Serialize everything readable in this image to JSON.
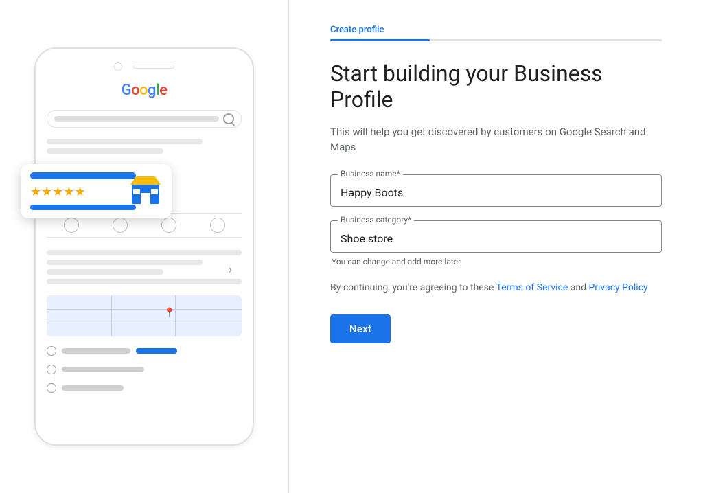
{
  "left": {
    "phone": {
      "google_logo": "Google",
      "stars": "★★★★★",
      "store_alt": "Store icon"
    }
  },
  "right": {
    "step_label": "Create profile",
    "step_bar_width": "30%",
    "title": "Start building your Business Profile",
    "subtitle": "This will help you get discovered by customers on Google Search and Maps",
    "business_name_label": "Business name*",
    "business_name_value": "Happy Boots",
    "business_category_label": "Business category*",
    "business_category_value": "Shoe store",
    "category_hint": "You can change and add more later",
    "tos_text_before": "By continuing, you're agreeing to these ",
    "tos_link1": "Terms of Service",
    "tos_text_mid": " and ",
    "tos_link2": "Privacy Policy",
    "next_button_label": "Next"
  }
}
